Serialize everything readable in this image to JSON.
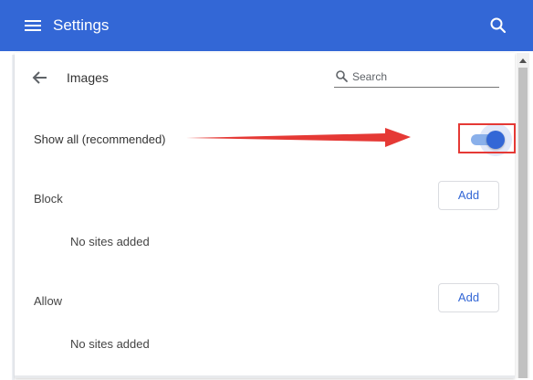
{
  "appbar": {
    "title": "Settings",
    "background": "#3367d6",
    "menu_icon": "hamburger-menu-icon",
    "search_icon": "search-icon"
  },
  "subpage": {
    "title": "Images",
    "back_icon": "arrow-back-icon",
    "search": {
      "placeholder": "Search",
      "value": ""
    }
  },
  "show_all": {
    "label": "Show all (recommended)",
    "toggle_on": true,
    "accent": "#3367d6"
  },
  "annotation": {
    "arrow_color": "#e53935",
    "highlight_color": "#e53935"
  },
  "sections": [
    {
      "title": "Block",
      "add_label": "Add",
      "empty_text": "No sites added"
    },
    {
      "title": "Allow",
      "add_label": "Add",
      "empty_text": "No sites added"
    }
  ]
}
